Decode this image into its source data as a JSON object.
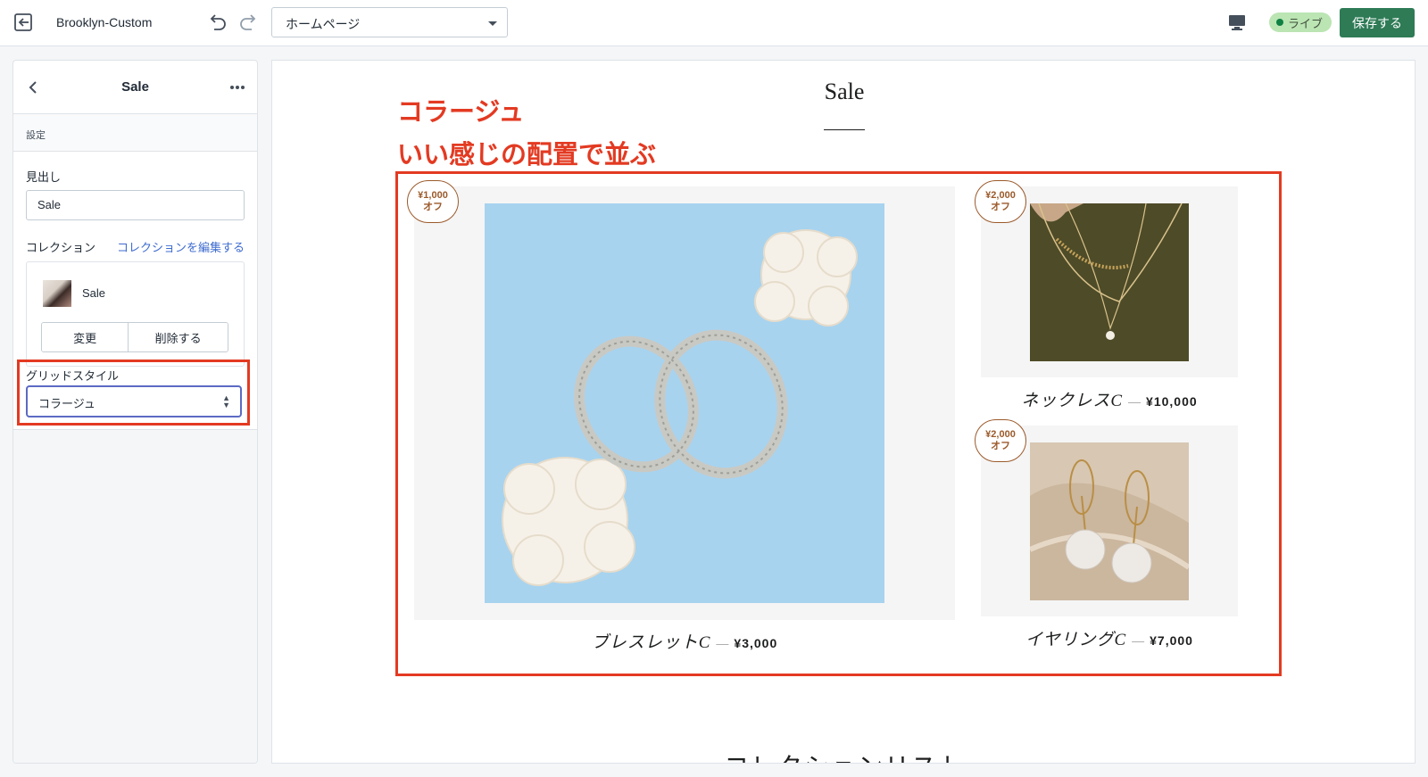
{
  "topbar": {
    "theme_name": "Brooklyn-Custom",
    "page_select": "ホームページ",
    "live_label": "ライブ",
    "save_label": "保存する"
  },
  "sidebar": {
    "title": "Sale",
    "section_label": "設定",
    "heading_label": "見出し",
    "heading_value": "Sale",
    "collection_label": "コレクション",
    "collection_edit_link": "コレクションを編集する",
    "collection_name": "Sale",
    "change_button": "変更",
    "delete_button": "削除する",
    "grid_style_label": "グリッドスタイル",
    "grid_style_value": "コラージュ"
  },
  "preview": {
    "section_title": "Sale",
    "annotation_line1": "コラージュ",
    "annotation_line2": "いい感じの配置で並ぶ",
    "next_section_title": "コレクションリスト",
    "products": [
      {
        "badge_amount": "¥1,000",
        "badge_suffix": "オフ",
        "name": "ブレスレットC",
        "separator": "—",
        "price": "¥3,000"
      },
      {
        "badge_amount": "¥2,000",
        "badge_suffix": "オフ",
        "name": "ネックレスC",
        "separator": "—",
        "price": "¥10,000"
      },
      {
        "badge_amount": "¥2,000",
        "badge_suffix": "オフ",
        "name": "イヤリングC",
        "separator": "—",
        "price": "¥7,000"
      }
    ]
  },
  "colors": {
    "annotation_red": "#e33a22",
    "save_green": "#2e7b56",
    "badge_brown": "#9b5a2b",
    "link_blue": "#3f6ccf"
  }
}
